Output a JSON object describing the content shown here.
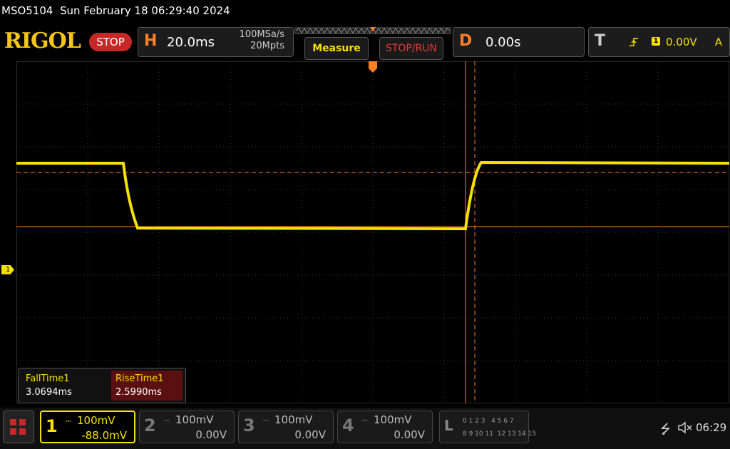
{
  "header": {
    "model": "MSO5104",
    "datetime": "Sun February 18 06:29:40 2024",
    "brand": "RIGOL",
    "run_state": "STOP"
  },
  "horizontal": {
    "letter": "H",
    "timebase": "20.0ms",
    "sample_rate": "100MSa/s",
    "memory_depth": "20Mpts"
  },
  "buttons": {
    "measure": "Measure",
    "stop_run": "STOP/RUN"
  },
  "delay": {
    "letter": "D",
    "value": "0.00s"
  },
  "trigger": {
    "letter": "T",
    "source": "1",
    "level": "0.00V",
    "mode": "A",
    "edge_icon": "rising-edge-icon"
  },
  "markers": {
    "ch1": "1"
  },
  "measurements": {
    "fall_label": "FallTime1",
    "fall_value": "3.0694ms",
    "rise_label": "RiseTime1",
    "rise_value": "2.5990ms"
  },
  "channels": [
    {
      "num": "1",
      "scale": "100mV",
      "offset": "-88.0mV",
      "active": true
    },
    {
      "num": "2",
      "scale": "100mV",
      "offset": "0.00V",
      "active": false
    },
    {
      "num": "3",
      "scale": "100mV",
      "offset": "0.00V",
      "active": false
    },
    {
      "num": "4",
      "scale": "100mV",
      "offset": "0.00V",
      "active": false
    }
  ],
  "logic": {
    "letter": "L",
    "row1": "0 1 2 3   4 5 6 7",
    "row2": "8 9 10 11  12 13 14 15"
  },
  "status": {
    "time": "06:29",
    "usb_icon": "usb-icon",
    "speaker_icon": "speaker-muted-icon"
  },
  "colors": {
    "ch1": "#f5e000",
    "accent": "#ff7f27",
    "stop": "#c62828",
    "brand": "#f5c518"
  }
}
